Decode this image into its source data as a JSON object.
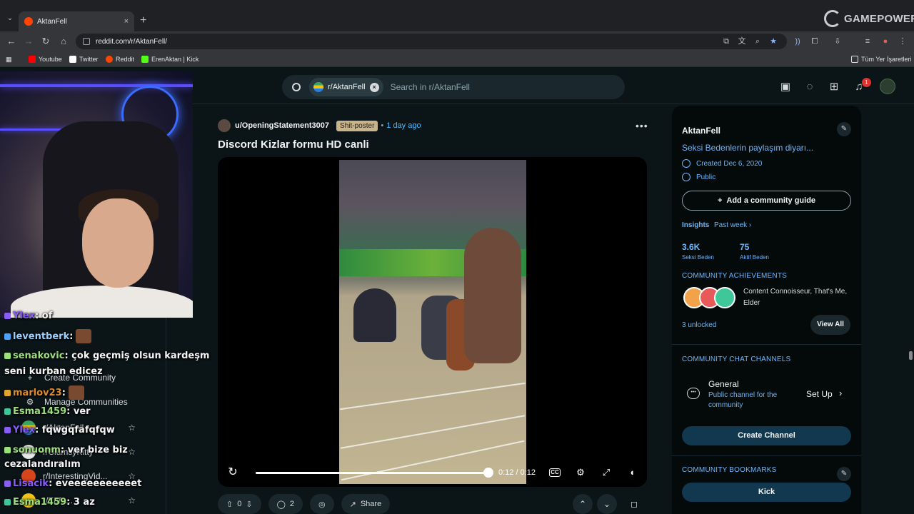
{
  "browser": {
    "tab_title": "AktanFell",
    "tab_close": "×",
    "new_tab": "+",
    "url": "reddit.com/r/AktanFell/",
    "overlay_logo": "GAMEPOWER",
    "bookmarks": [
      {
        "label": "Youtube",
        "icon": "youtube-icon",
        "color": "#ff0000"
      },
      {
        "label": "Twitter",
        "icon": "x-icon",
        "color": "#ffffff"
      },
      {
        "label": "Reddit",
        "icon": "reddit-icon",
        "color": "#ff4500"
      },
      {
        "label": "ErenAktan | Kick",
        "icon": "kick-icon",
        "color": "#53fc18"
      }
    ],
    "bookmarks_folder": "Tüm Yer İşaretleri"
  },
  "header": {
    "search_chip": "r/AktanFell",
    "search_placeholder": "Search in r/AktanFell",
    "notification_count": "1"
  },
  "left_sidebar": {
    "actions": [
      {
        "label": "Create Community",
        "icon": "plus-icon"
      },
      {
        "label": "Manage Communities",
        "icon": "gear-icon"
      }
    ],
    "communities": [
      {
        "label": "r/AktanFell",
        "color": "#3ba55d"
      },
      {
        "label": "r/ClumsyKitty",
        "color": "#e8e8e8"
      },
      {
        "label": "r/InterestingVid...",
        "color": "#d6451c"
      },
      {
        "label": "r/Kafe...",
        "color": "#f0c419"
      }
    ]
  },
  "chat": {
    "lines": [
      {
        "user": "Ylex",
        "msg": ": of",
        "color": "#8a5cf6"
      },
      {
        "user": "leventberk",
        "msg": " :",
        "color": "#9ad0ff"
      },
      {
        "user": "senakovic",
        "msg": ": çok geçmiş olsun kardeşm",
        "color": "#9be07a"
      },
      {
        "user": "marlov23",
        "msg": " :",
        "color": "#e08a2e"
      },
      {
        "user": "Esma1459",
        "msg": ": ver",
        "color": "#9be07a"
      },
      {
        "user": "Ylex",
        "msg": ": fqwgqfafqfqw",
        "color": "#8a5cf6"
      },
      {
        "user": "sonuonm",
        "msg": ": ver bize biz",
        "color": "#9be07a"
      },
      {
        "user": "Lisacik",
        "msg": ": eveeeeeeeeeeet",
        "color": "#8a5cf6"
      },
      {
        "user": "Esma1459",
        "msg": ": 3 az",
        "color": "#9be07a"
      }
    ],
    "wrap1": "seni kurban edicez",
    "wrap2": "cezalandıralım"
  },
  "post": {
    "author": "u/OpeningStatement3007",
    "flair": "Shit-poster",
    "separator": "•",
    "time": "1 day ago",
    "more": "•••",
    "title": "Discord Kizlar formu HD canli",
    "video": {
      "current": "0:12",
      "total": "0:12",
      "time_text": "0:12 / 0:12",
      "progress": 1.0,
      "cc": "CC"
    },
    "actions": {
      "upvotes": "0",
      "comments": "2",
      "share": "Share"
    }
  },
  "community": {
    "name": "AktanFell",
    "description": "Seksi Bedenlerin paylaşım diyarı...",
    "created": "Created Dec 6, 2020",
    "visibility": "Public",
    "guide_button": "Add a community guide",
    "insights_label": "Insights",
    "insights_period": "Past week",
    "stats": [
      {
        "value": "3.6K",
        "label": "Seksi Beden"
      },
      {
        "value": "75",
        "label": "Aktif Beden"
      }
    ],
    "achievements_header": "COMMUNITY ACHIEVEMENTS",
    "achievements_text": "Content Connoisseur, That's Me, Elder",
    "achievements_unlocked": "3 unlocked",
    "view_all": "View All",
    "chat_header": "COMMUNITY CHAT CHANNELS",
    "channel": {
      "name": "General",
      "description": "Public channel for the community",
      "setup": "Set Up"
    },
    "create_channel": "Create Channel",
    "bookmarks_header": "COMMUNITY BOOKMARKS",
    "bookmark_kick": "Kick"
  }
}
